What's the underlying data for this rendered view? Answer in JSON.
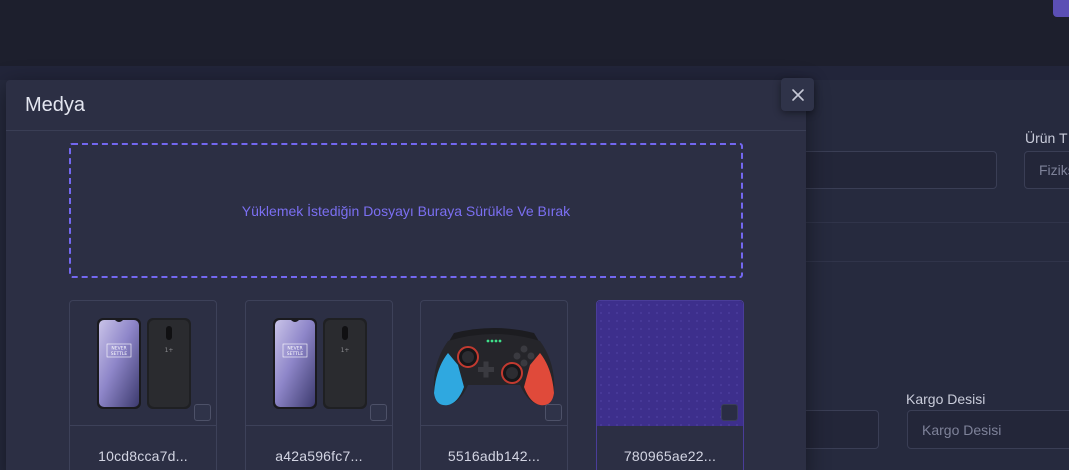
{
  "modal": {
    "title": "Medya",
    "close_icon": "close-icon",
    "dropzone_text": "Yüklemek İstediğin Dosyayı Buraya Sürükle Ve Bırak"
  },
  "media_items": [
    {
      "name": "10cd8cca7d...",
      "thumbnail": "oneplus-7-phone"
    },
    {
      "name": "a42a596fc7...",
      "thumbnail": "oneplus-7-phone"
    },
    {
      "name": "5516adb142...",
      "thumbnail": "gamepad-controller"
    },
    {
      "name": "780965ae22...",
      "thumbnail": "purple-pattern"
    }
  ],
  "background_form": {
    "product_type_label": "Ürün T",
    "product_type_value": "Fiziks",
    "cargo_label": "Kargo Desisi",
    "cargo_placeholder": "Kargo Desisi"
  },
  "colors": {
    "accent": "#7367f0",
    "modal_bg": "#2c2f44",
    "page_bg": "#252839"
  }
}
